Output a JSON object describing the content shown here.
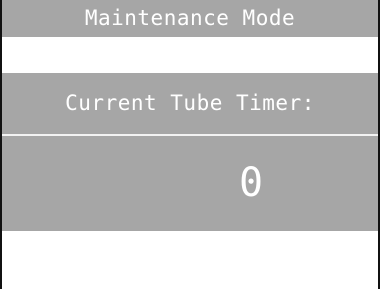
{
  "header": {
    "title": "Maintenance Mode"
  },
  "tube_timer": {
    "label": "Current Tube Timer:",
    "value": "0"
  },
  "colors": {
    "panel": "#a6a6a6",
    "text": "#ffffff",
    "background": "#ffffff",
    "border": "#111111"
  }
}
